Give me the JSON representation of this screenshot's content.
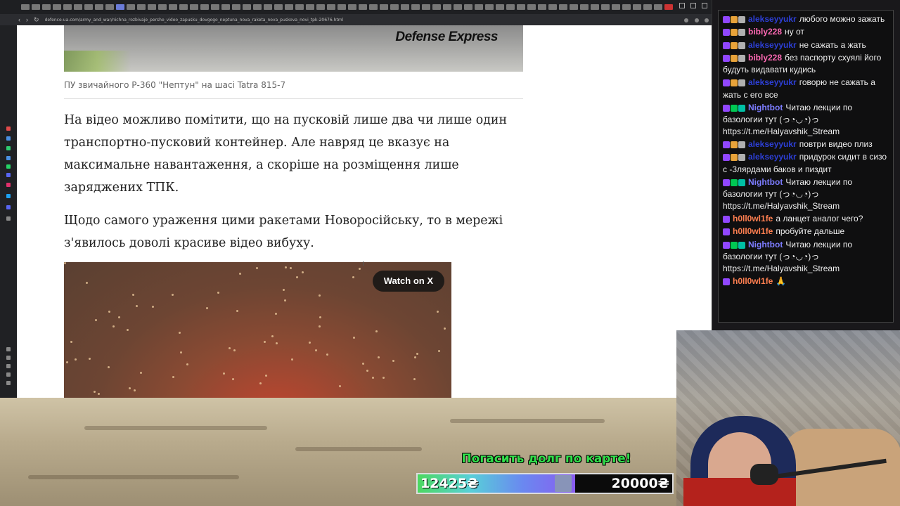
{
  "browser": {
    "address": "defence-ua.com/army_and_war/nichna_rozbivaje_pershe_video_zapusku_dovgogo_neptuna_nova_raketa_nova_puskova_novi_tpk-20676.html"
  },
  "article": {
    "brand": "Defense Express",
    "caption": "ПУ звичайного Р-360 \"Нептун\" на шасі Tatra 815-7",
    "paragraph1": "На відео можливо помітити, що на пусковій лише два чи лише один транспортно-пусковий контейнер. Але навряд це вказує на максимальне навантаження, а скоріше на розміщення лише заряджених ТПК.",
    "paragraph2": "Щодо самого ураження цими ракетами Новоросійську, то в мережі з'явилось доволі красиве відео вибуху.",
    "video": {
      "watch_label": "Watch on X"
    }
  },
  "chat": {
    "messages": [
      {
        "user": "alekseyyukr",
        "color": "#2d3fd6",
        "badges": [
          "#9147ff",
          "#e8a33a",
          "#b0b0b0"
        ],
        "text": "любого можно зажать"
      },
      {
        "user": "bibly228",
        "color": "#ff69b4",
        "badges": [
          "#9147ff",
          "#e8a33a",
          "#b0b0b0"
        ],
        "text": "ну от"
      },
      {
        "user": "alekseyyukr",
        "color": "#2d3fd6",
        "badges": [
          "#9147ff",
          "#e8a33a",
          "#b0b0b0"
        ],
        "text": "не сажать а жать"
      },
      {
        "user": "bibly228",
        "color": "#ff69b4",
        "badges": [
          "#9147ff",
          "#e8a33a",
          "#b0b0b0"
        ],
        "text": "без паспорту схуялі його будуть видавати кудись"
      },
      {
        "user": "alekseyyukr",
        "color": "#2d3fd6",
        "badges": [
          "#9147ff",
          "#e8a33a",
          "#b0b0b0"
        ],
        "text": "говорю не сажать а жать с его все"
      },
      {
        "user": "Nightbot",
        "color": "#7c7cff",
        "badges": [
          "#9147ff",
          "#00c853",
          "#00bfa5"
        ],
        "text": "Читаю лекции по базологии тут (っ◔◡◔)っ https://t.me/Halyavshik_Stream"
      },
      {
        "user": "alekseyyukr",
        "color": "#2d3fd6",
        "badges": [
          "#9147ff",
          "#e8a33a",
          "#b0b0b0"
        ],
        "text": "повтри видео плиз"
      },
      {
        "user": "alekseyyukr",
        "color": "#2d3fd6",
        "badges": [
          "#9147ff",
          "#e8a33a",
          "#b0b0b0"
        ],
        "text": "придурок сидит в сизо с -3лярдами баков и пиздит"
      },
      {
        "user": "Nightbot",
        "color": "#7c7cff",
        "badges": [
          "#9147ff",
          "#00c853",
          "#00bfa5"
        ],
        "text": "Читаю лекции по базологии тут (っ◔◡◔)っ https://t.me/Halyavshik_Stream"
      },
      {
        "user": "h0ll0wl1fe",
        "color": "#ff7f50",
        "badges": [
          "#9147ff"
        ],
        "text": "а ланцет аналог чего?"
      },
      {
        "user": "h0ll0wl1fe",
        "color": "#ff7f50",
        "badges": [
          "#9147ff"
        ],
        "text": "пробуйте дальше"
      },
      {
        "user": "Nightbot",
        "color": "#7c7cff",
        "badges": [
          "#9147ff",
          "#00c853",
          "#00bfa5"
        ],
        "text": "Читаю лекции по базологии тут (っ◔◡◔)っ https://t.me/Halyavshik_Stream"
      },
      {
        "user": "h0ll0wl1fe",
        "color": "#ff7f50",
        "badges": [
          "#9147ff"
        ],
        "text": "🙏"
      }
    ]
  },
  "donation": {
    "goal_title": "Погасить долг по карте!",
    "current": "12425₴",
    "target": "20000₴",
    "progress": 0.62
  }
}
